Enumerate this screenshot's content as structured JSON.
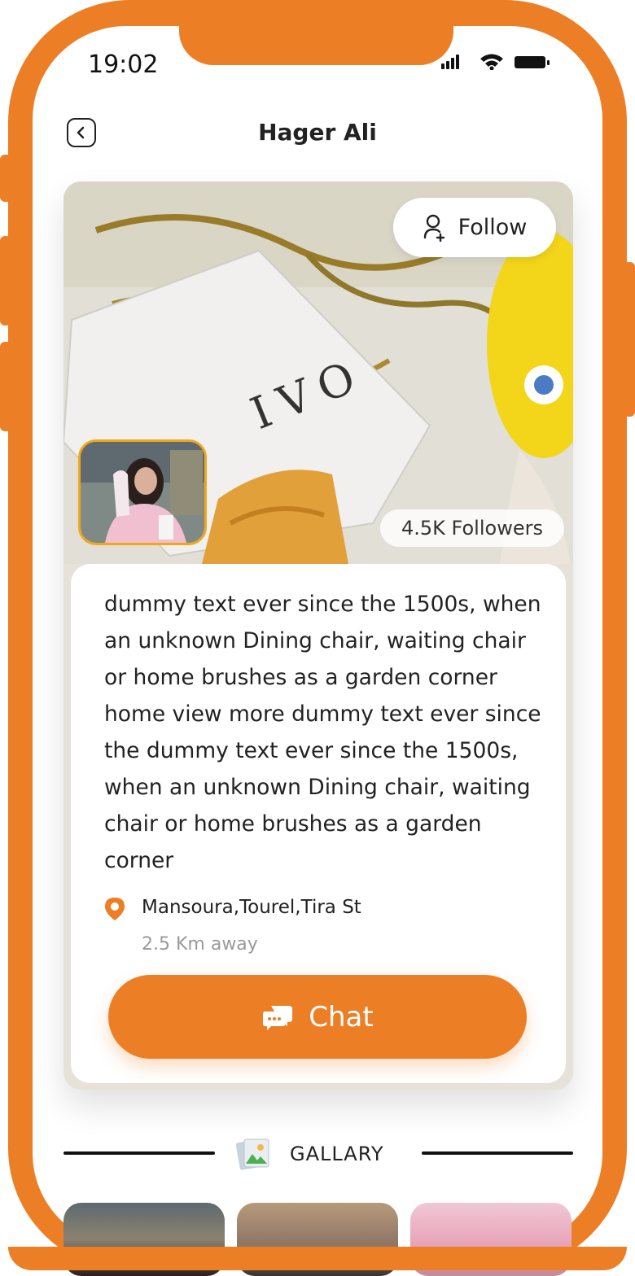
{
  "status_bar": {
    "time": "19:02"
  },
  "header": {
    "title": "Hager Ali"
  },
  "profile": {
    "follow_label": "Follow",
    "followers": "4.5K Followers",
    "description": "dummy text ever since the 1500s, when an unknown Dining chair, waiting chair or home brushes as a garden corner home  view more dummy text ever since the dummy text ever since the 1500s, when an unknown Dining chair, waiting chair or home brushes as a garden corner",
    "location": "Mansoura,Tourel,Tira St",
    "distance": "2.5 Km away",
    "chat_label": "Chat"
  },
  "gallery": {
    "label": "GALLARY"
  },
  "colors": {
    "accent": "#ec7f25",
    "avatar_border": "#f0a81a",
    "text": "#222222",
    "muted": "#9a9a9a"
  }
}
